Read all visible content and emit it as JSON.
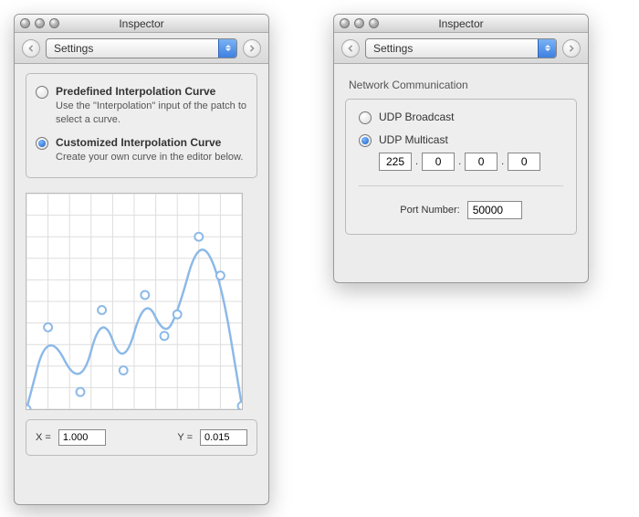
{
  "left": {
    "title": "Inspector",
    "popup": "Settings",
    "radios": {
      "predefined": {
        "label": "Predefined Interpolation Curve",
        "desc": "Use the \"Interpolation\" input of the patch to select a curve."
      },
      "customized": {
        "label": "Customized Interpolation Curve",
        "desc": "Create your own curve in the editor below."
      }
    },
    "x_label": "X =",
    "y_label": "Y =",
    "x_value": "1.000",
    "y_value": "0.015"
  },
  "right": {
    "title": "Inspector",
    "popup": "Settings",
    "section": "Network Communication",
    "udp_broadcast": "UDP Broadcast",
    "udp_multicast": "UDP Multicast",
    "ip": {
      "a": "225",
      "b": "0",
      "c": "0",
      "d": "0"
    },
    "dot": ".",
    "port_label": "Port Number:",
    "port_value": "50000"
  },
  "chart_data": {
    "type": "line",
    "title": "",
    "xlabel": "",
    "ylabel": "",
    "xlim": [
      0,
      1
    ],
    "ylim": [
      0,
      1
    ],
    "grid": true,
    "control_points": [
      {
        "x": 0.0,
        "y": 0.0
      },
      {
        "x": 0.1,
        "y": 0.38
      },
      {
        "x": 0.25,
        "y": 0.08
      },
      {
        "x": 0.35,
        "y": 0.46
      },
      {
        "x": 0.45,
        "y": 0.18
      },
      {
        "x": 0.55,
        "y": 0.53
      },
      {
        "x": 0.64,
        "y": 0.34
      },
      {
        "x": 0.7,
        "y": 0.44
      },
      {
        "x": 0.8,
        "y": 0.8
      },
      {
        "x": 0.9,
        "y": 0.62
      },
      {
        "x": 1.0,
        "y": 0.015
      }
    ],
    "curve_color": "#8cb9e8"
  }
}
